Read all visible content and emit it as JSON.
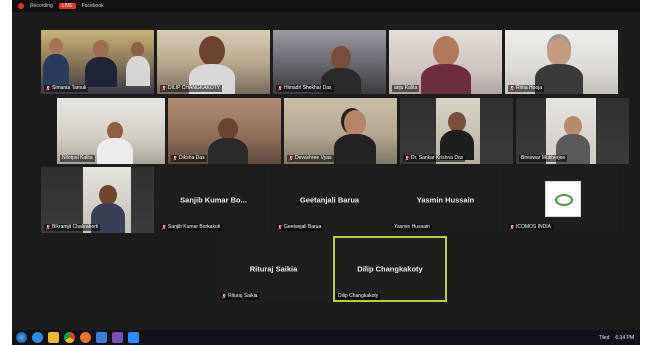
{
  "topbar": {
    "left_text": "Recording",
    "live_badge": "LIVE",
    "right_text": "Facebook"
  },
  "participants": [
    {
      "id": "simanta",
      "name": "Simanta Tamuli",
      "has_video": true
    },
    {
      "id": "dilip-upper",
      "name": "DILIP CHANGKAKOTY",
      "has_video": true
    },
    {
      "id": "himadri",
      "name": "Himadri Shekhar Das",
      "has_video": true
    },
    {
      "id": "anju",
      "name": "anju Kalita",
      "has_video": true
    },
    {
      "id": "rima",
      "name": "Rima Hooja",
      "has_video": true
    },
    {
      "id": "nilotpal",
      "name": "Nilotpal Kalita",
      "has_video": true
    },
    {
      "id": "diksha",
      "name": "Diksha Das",
      "has_video": true
    },
    {
      "id": "devashree",
      "name": "Devashree Vyas",
      "has_video": true
    },
    {
      "id": "sankar",
      "name": "Dr. Sankar Krishna Das",
      "has_video": true
    },
    {
      "id": "bireswar",
      "name": "Bireswar Mukherjee",
      "has_video": true
    },
    {
      "id": "bikramjit",
      "name": "Bikramjit Chakraborti",
      "has_video": true
    },
    {
      "id": "sanjib",
      "name": "Sanjib Kumar Borkakoti",
      "display_name": "Sanjib Kumar Bo...",
      "has_video": false
    },
    {
      "id": "geetanjali",
      "name": "Geetanjali Barua",
      "display_name": "Geetanjali Barua",
      "has_video": false
    },
    {
      "id": "yasmin",
      "name": "Yasmin Hussain",
      "display_name": "Yasmin Hussain",
      "has_video": false
    },
    {
      "id": "icomos",
      "name": "ICOMOS INDIA",
      "has_video": true
    },
    {
      "id": "rituraj",
      "name": "Rituraj Saikia",
      "display_name": "Rituraj Saikia",
      "has_video": false
    },
    {
      "id": "dilip-lower",
      "name": "Dilip Changkakoty",
      "display_name": "Dilip Changkakoty",
      "has_video": false,
      "active_speaker": true
    }
  ],
  "taskbar": {
    "icons": [
      "windows-start-icon",
      "internet-explorer-icon",
      "file-explorer-icon",
      "chrome-icon",
      "edge-icon",
      "mail-icon",
      "visual-studio-icon",
      "zoom-icon"
    ],
    "tray_text": "Tiled",
    "clock_time": "6:34 PM"
  },
  "colors": {
    "active_border": "#b6d23a",
    "mic_muted": "#e03a2f",
    "background": "#1c1c1c"
  }
}
